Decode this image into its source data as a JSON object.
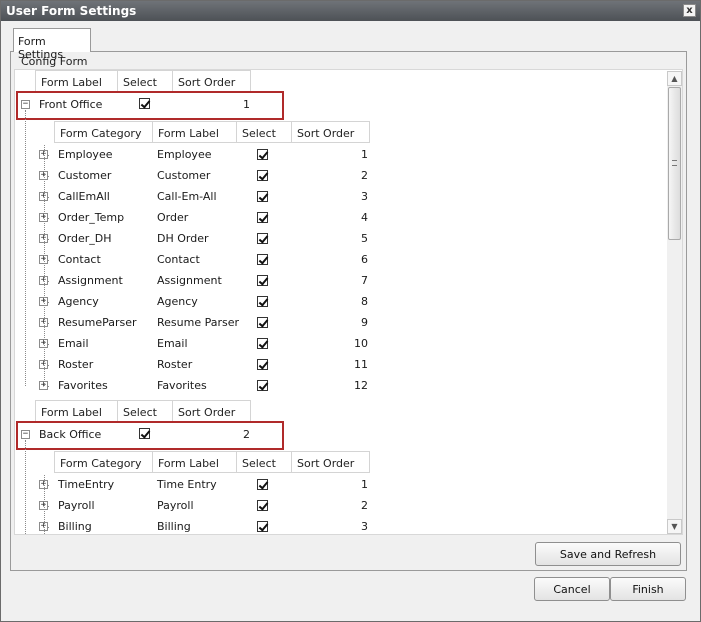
{
  "window": {
    "title": "User Form Settings",
    "close_glyph": "x"
  },
  "tab": {
    "label": "Form Settings"
  },
  "config_label": "Config Form",
  "outer_headers": {
    "form_label": "Form Label",
    "select": "Select",
    "sort_order": "Sort Order"
  },
  "inner_headers": {
    "form_category": "Form Category",
    "form_label": "Form Label",
    "select": "Select",
    "sort_order": "Sort Order"
  },
  "groups": [
    {
      "name": "Front Office",
      "selected": true,
      "sort_order": "1",
      "rows": [
        {
          "category": "Employee",
          "label": "Employee",
          "selected": true,
          "order": "1"
        },
        {
          "category": "Customer",
          "label": "Customer",
          "selected": true,
          "order": "2"
        },
        {
          "category": "CallEmAll",
          "label": "Call-Em-All",
          "selected": true,
          "order": "3"
        },
        {
          "category": "Order_Temp",
          "label": "Order",
          "selected": true,
          "order": "4"
        },
        {
          "category": "Order_DH",
          "label": "DH Order",
          "selected": true,
          "order": "5"
        },
        {
          "category": "Contact",
          "label": "Contact",
          "selected": true,
          "order": "6"
        },
        {
          "category": "Assignment",
          "label": "Assignment",
          "selected": true,
          "order": "7"
        },
        {
          "category": "Agency",
          "label": "Agency",
          "selected": true,
          "order": "8"
        },
        {
          "category": "ResumeParser",
          "label": "Resume Parser",
          "selected": true,
          "order": "9"
        },
        {
          "category": "Email",
          "label": "Email",
          "selected": true,
          "order": "10"
        },
        {
          "category": "Roster",
          "label": "Roster",
          "selected": true,
          "order": "11"
        },
        {
          "category": "Favorites",
          "label": "Favorites",
          "selected": true,
          "order": "12"
        }
      ]
    },
    {
      "name": "Back Office",
      "selected": true,
      "sort_order": "2",
      "rows": [
        {
          "category": "TimeEntry",
          "label": "Time Entry",
          "selected": true,
          "order": "1"
        },
        {
          "category": "Payroll",
          "label": "Payroll",
          "selected": true,
          "order": "2"
        },
        {
          "category": "Billing",
          "label": "Billing",
          "selected": true,
          "order": "3"
        }
      ]
    }
  ],
  "buttons": {
    "save_refresh": "Save and Refresh",
    "cancel": "Cancel",
    "finish": "Finish"
  },
  "colors": {
    "highlight_border": "#b02a2a",
    "titlebar": "#5a5e63"
  },
  "icons": {
    "expand": "plus-box-icon",
    "collapse": "minus-box-icon",
    "close": "close-icon",
    "check": "checkmark-icon"
  }
}
